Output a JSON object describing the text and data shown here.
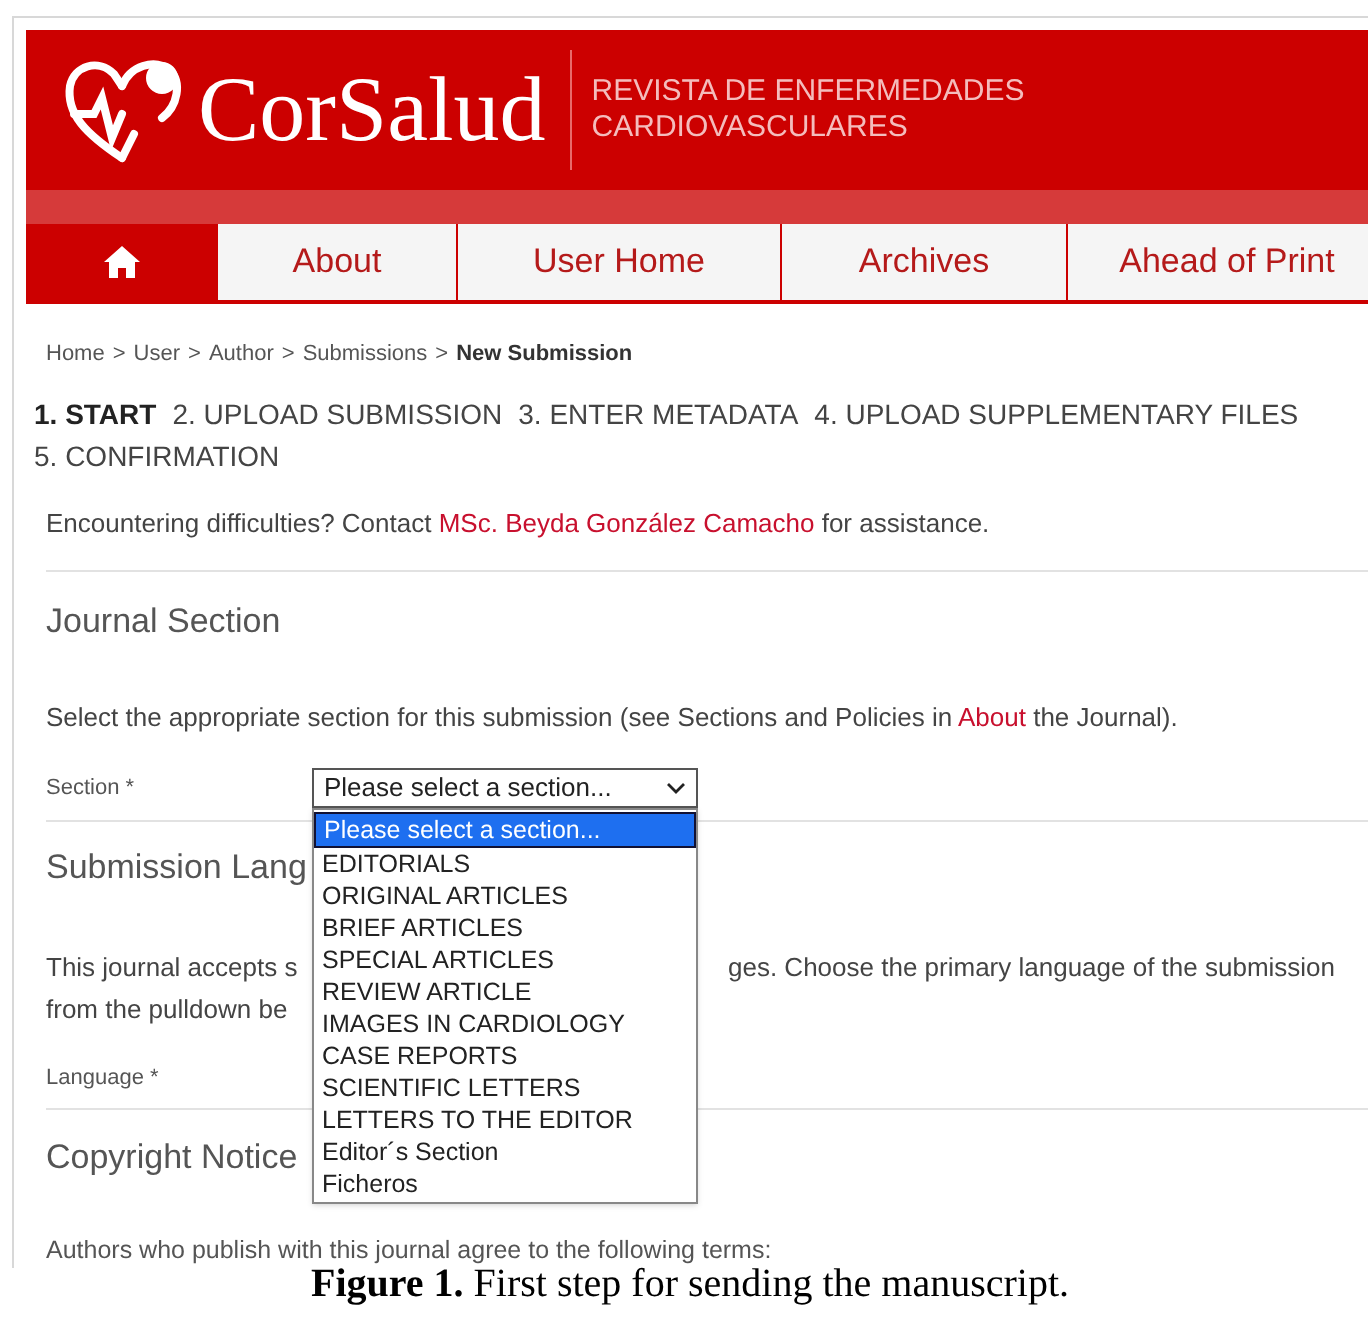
{
  "header": {
    "logo_text": "CorSalud",
    "tagline_lines": [
      "REVISTA DE ENFERMEDADES",
      "CARDIOVASCULARES"
    ]
  },
  "nav": [
    {
      "kind": "home",
      "selected": true
    },
    {
      "kind": "link",
      "label": "About",
      "selected": false
    },
    {
      "kind": "link",
      "label": "User Home",
      "selected": false
    },
    {
      "kind": "link",
      "label": "Archives",
      "selected": false
    },
    {
      "kind": "link",
      "label": "Ahead of Print",
      "selected": false
    }
  ],
  "breadcrumb": [
    {
      "label": "Home",
      "current": false
    },
    {
      "label": "User",
      "current": false
    },
    {
      "label": "Author",
      "current": false
    },
    {
      "label": "Submissions",
      "current": false
    },
    {
      "label": "New Submission",
      "current": true
    }
  ],
  "breadcrumb_separator": ">",
  "steps": [
    {
      "label": "1. START",
      "selected": true
    },
    {
      "label": "2. UPLOAD SUBMISSION",
      "selected": false
    },
    {
      "label": "3. ENTER METADATA",
      "selected": false
    },
    {
      "label": "4. UPLOAD SUPPLEMENTARY FILES",
      "selected": false
    },
    {
      "label": "5. CONFIRMATION",
      "selected": false
    }
  ],
  "contact": {
    "before": "Encountering difficulties? Contact",
    "link": "MSc. Beyda González Camacho",
    "after": "for assistance."
  },
  "journal_section": {
    "heading": "Journal Section",
    "instructions": {
      "before": "Select the appropriate section for this submission (see Sections and Policies in",
      "link": "About",
      "after": "the Journal)."
    },
    "field_label": "Section *",
    "select": {
      "value": "Please select a section...",
      "expanded": true,
      "options": [
        {
          "label": "Please select a section...",
          "selected": true
        },
        {
          "label": "EDITORIALS",
          "selected": false
        },
        {
          "label": "ORIGINAL ARTICLES",
          "selected": false
        },
        {
          "label": "BRIEF ARTICLES",
          "selected": false
        },
        {
          "label": "SPECIAL ARTICLES",
          "selected": false
        },
        {
          "label": "REVIEW ARTICLE",
          "selected": false
        },
        {
          "label": "IMAGES IN CARDIOLOGY",
          "selected": false
        },
        {
          "label": "CASE REPORTS",
          "selected": false
        },
        {
          "label": "SCIENTIFIC LETTERS",
          "selected": false
        },
        {
          "label": "LETTERS TO THE EDITOR",
          "selected": false
        },
        {
          "label": "Editor´s Section",
          "selected": false
        },
        {
          "label": "Ficheros",
          "selected": false
        }
      ]
    }
  },
  "submission_language": {
    "heading": "Submission Lang",
    "paragraph_line1_left": "This journal accepts s",
    "paragraph_line1_right": "ges. Choose the primary language of the submission",
    "paragraph_line2": "from the pulldown be",
    "field_label": "Language *"
  },
  "copyright": {
    "heading": "Copyright Notice",
    "text": "Authors who publish with this journal agree to the following terms:"
  },
  "caption": "**Figure 1.** First step for sending the manuscript."
}
